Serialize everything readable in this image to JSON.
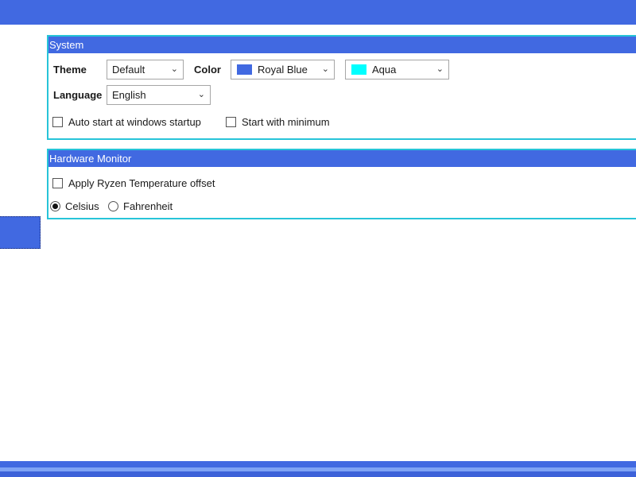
{
  "colors": {
    "accent": "#4169e1",
    "border": "#27c4d8",
    "royal_blue_swatch": "#4169e1",
    "aqua_swatch": "#00ffff"
  },
  "system": {
    "title": "System",
    "theme_label": "Theme",
    "theme_value": "Default",
    "color_label": "Color",
    "color_primary_value": "Royal Blue",
    "color_secondary_value": "Aqua",
    "language_label": "Language",
    "language_value": "English",
    "auto_start_label": "Auto start at windows startup",
    "start_min_label": "Start with minimum"
  },
  "hardware": {
    "title": "Hardware Monitor",
    "ryzen_offset_label": "Apply Ryzen Temperature offset",
    "celsius_label": "Celsius",
    "fahrenheit_label": "Fahrenheit",
    "selected_unit": "Celsius"
  }
}
